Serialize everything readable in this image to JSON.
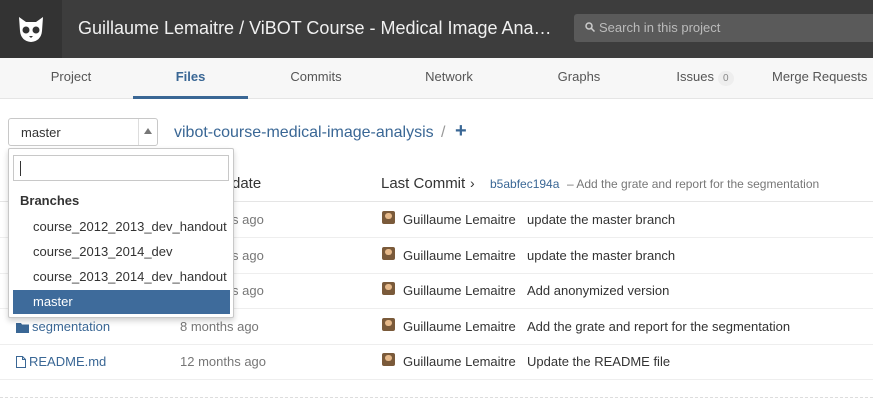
{
  "header": {
    "title": "Guillaume Lemaitre / ViBOT Course - Medical Image Ana…",
    "search_placeholder": "Search in this project"
  },
  "nav": {
    "tabs": [
      {
        "label": "Project"
      },
      {
        "label": "Files"
      },
      {
        "label": "Commits"
      },
      {
        "label": "Network"
      },
      {
        "label": "Graphs"
      },
      {
        "label": "Issues",
        "badge": "0"
      },
      {
        "label": "Merge Requests"
      }
    ],
    "active": "Files"
  },
  "branch": {
    "selected": "master",
    "repo_path": "vibot-course-medical-image-analysis",
    "separator": "/",
    "add": "+"
  },
  "dropdown": {
    "header": "Branches",
    "items": [
      "course_2012_2013_dev_handout",
      "course_2013_2014_dev",
      "course_2013_2014_dev_handout",
      "master"
    ],
    "selected": "master"
  },
  "table": {
    "col_update": "date",
    "col_last_commit": "Last Commit",
    "commit_sha": "b5abfec194a",
    "commit_msg": "– Add the grate and report for the segmentation",
    "rows": [
      {
        "name": "",
        "age": "s ago",
        "author": "Guillaume Lemaitre",
        "message": "update the master branch"
      },
      {
        "name": "",
        "age": "s ago",
        "author": "Guillaume Lemaitre",
        "message": "update the master branch"
      },
      {
        "name": "",
        "age": "s ago",
        "author": "Guillaume Lemaitre",
        "message": "Add anonymized version"
      },
      {
        "name": "segmentation",
        "age": "8 months ago",
        "author": "Guillaume Lemaitre",
        "message": "Add the grate and report for the segmentation"
      },
      {
        "name": "README.md",
        "age": "12 months ago",
        "author": "Guillaume Lemaitre",
        "message": "Update the README file"
      }
    ]
  },
  "colors": {
    "accent": "#3a6795",
    "header_bg": "#3d3d3d",
    "selected_bg": "#3e6b9b"
  }
}
